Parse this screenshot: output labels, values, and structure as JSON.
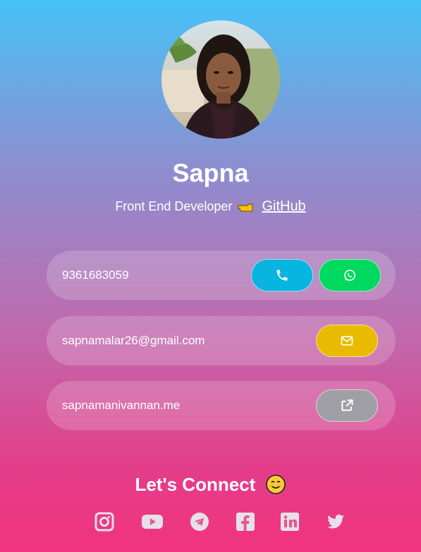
{
  "profile": {
    "name": "Sapna",
    "role": "Front End Developer",
    "github_label": "GitHub"
  },
  "contacts": {
    "phone": "9361683059",
    "email": "sapnamalar26@gmail.com",
    "website": "sapnamanivannan.me"
  },
  "connect": {
    "heading": "Let's Connect"
  },
  "colors": {
    "call_button": "#08b4e0",
    "whatsapp_button": "#00d95f",
    "mail_button": "#e8bb00",
    "link_button": "#a19fa6"
  },
  "icons": {
    "call": "phone-icon",
    "whatsapp": "whatsapp-icon",
    "mail": "envelope-icon",
    "link": "external-link-icon",
    "socials": [
      "instagram-icon",
      "youtube-icon",
      "telegram-icon",
      "facebook-icon",
      "linkedin-icon",
      "twitter-icon"
    ]
  }
}
